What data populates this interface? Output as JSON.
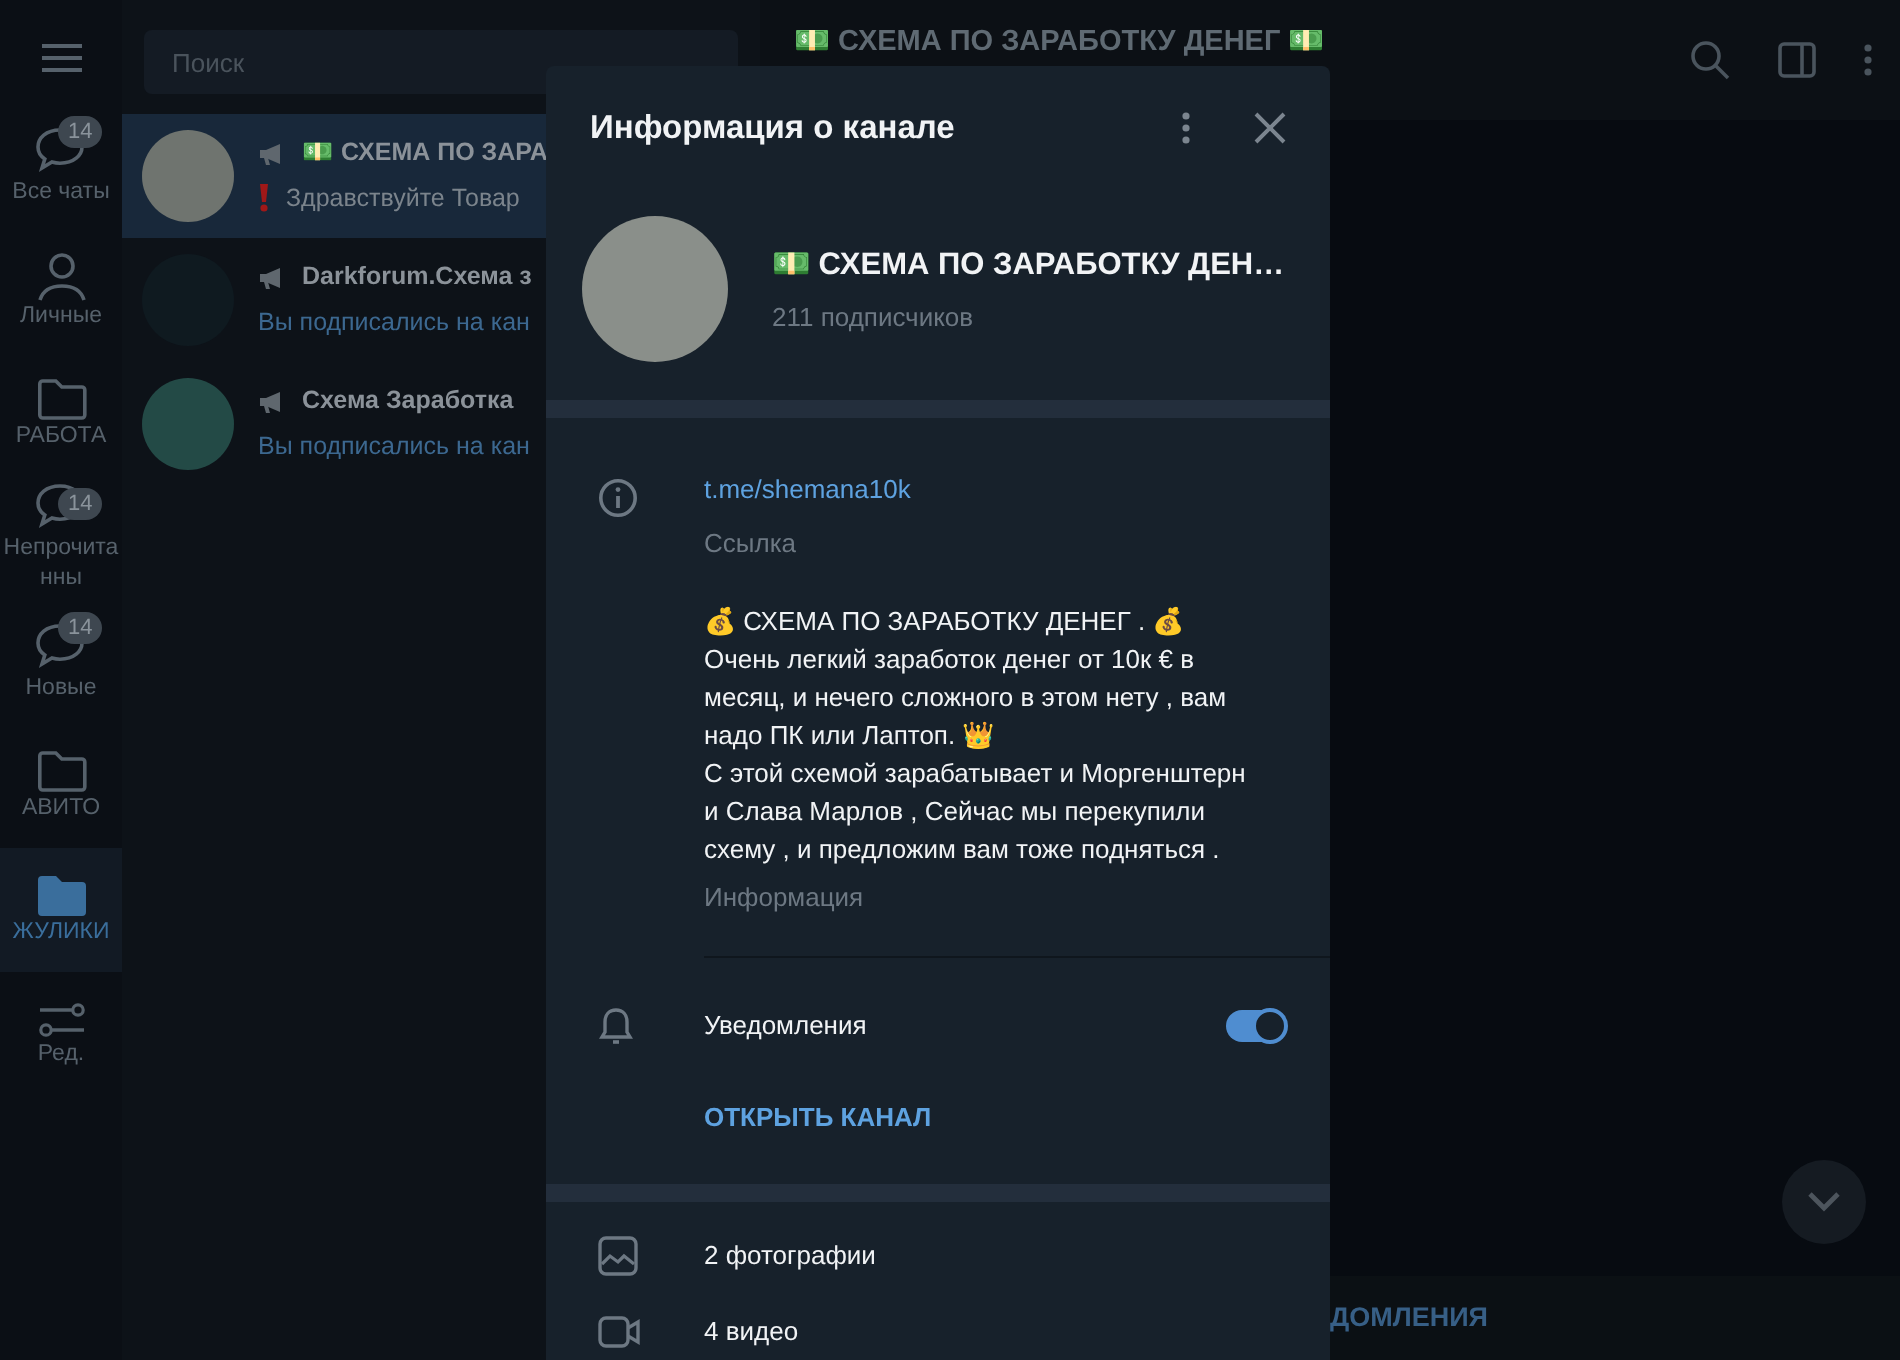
{
  "folders": [
    {
      "label": "Все чаты",
      "kind": "chats",
      "badge": "14",
      "selected": false
    },
    {
      "label": "Личные",
      "kind": "person",
      "selected": false
    },
    {
      "label": "РАБОТА",
      "kind": "folder",
      "selected": false
    },
    {
      "label": "Непрочитанны",
      "kind": "chat",
      "badge": "14",
      "selected": false
    },
    {
      "label": "Новые",
      "kind": "chat",
      "badge": "14",
      "selected": false
    },
    {
      "label": "АВИТО",
      "kind": "folder",
      "selected": false
    },
    {
      "label": "ЖУЛИКИ",
      "kind": "folder",
      "selected": true
    },
    {
      "label": "Ред.",
      "kind": "edit",
      "selected": false
    }
  ],
  "search": {
    "placeholder": "Поиск"
  },
  "chats": [
    {
      "title": "💵 СХЕМА ПО ЗАРА",
      "preview": "Здравствуйте Товар",
      "alert": true,
      "selected": true
    },
    {
      "title": "Darkforum.Схема з",
      "preview": "Вы подписались на кан",
      "alert": false,
      "selected": false
    },
    {
      "title": "Схема Заработка",
      "preview": "Вы подписались на кан",
      "alert": false,
      "selected": false
    }
  ],
  "chat_header": {
    "title": "💵 СХЕМА ПО ЗАРАБОТКУ ДЕНЕГ 💵"
  },
  "modal": {
    "title": "Информация о канале",
    "channel_name": "💵 СХЕМА ПО ЗАРАБОТКУ ДЕН…",
    "subscribers": "211 подписчиков",
    "link": "t.me/shemana10k",
    "link_caption": "Ссылка",
    "description": "💰 СХЕМА ПО ЗАРАБОТКУ ДЕНЕГ . 💰\nОчень легкий заработок денег от 10к € в месяц, и нечего сложного в этом нету , вам надо ПК или Лаптоп. 👑\nС этой схемой зарабатывает и Моргенштерн и Слава Марлов , Сейчас мы перекупили схему , и предложим вам тоже подняться .",
    "description_caption": "Информация",
    "notifications": {
      "label": "Уведомления",
      "on": true
    },
    "open_button": "ОТКРЫТЬ КАНАЛ",
    "media": [
      {
        "kind": "photo",
        "label": "2 фотографии"
      },
      {
        "kind": "video",
        "label": "4 видео"
      }
    ]
  },
  "bottom_bar": {
    "label": "ДОМЛЕНИЯ"
  }
}
